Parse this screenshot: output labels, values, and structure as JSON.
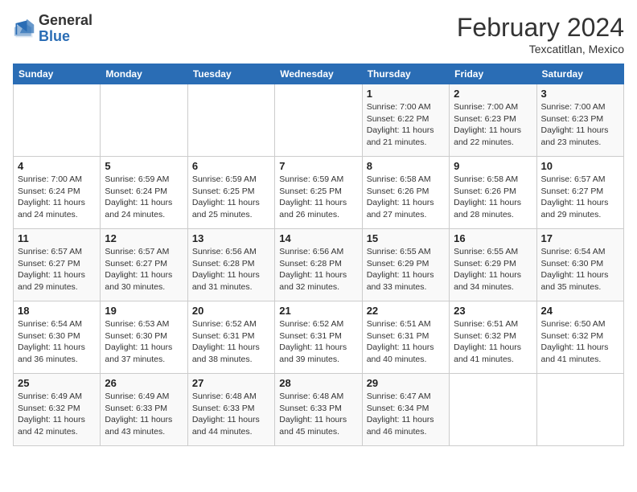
{
  "header": {
    "logo": {
      "line1": "General",
      "line2": "Blue"
    },
    "title": "February 2024",
    "subtitle": "Texcatitlan, Mexico"
  },
  "days_of_week": [
    "Sunday",
    "Monday",
    "Tuesday",
    "Wednesday",
    "Thursday",
    "Friday",
    "Saturday"
  ],
  "weeks": [
    [
      {
        "day": "",
        "info": ""
      },
      {
        "day": "",
        "info": ""
      },
      {
        "day": "",
        "info": ""
      },
      {
        "day": "",
        "info": ""
      },
      {
        "day": "1",
        "info": "Sunrise: 7:00 AM\nSunset: 6:22 PM\nDaylight: 11 hours\nand 21 minutes."
      },
      {
        "day": "2",
        "info": "Sunrise: 7:00 AM\nSunset: 6:23 PM\nDaylight: 11 hours\nand 22 minutes."
      },
      {
        "day": "3",
        "info": "Sunrise: 7:00 AM\nSunset: 6:23 PM\nDaylight: 11 hours\nand 23 minutes."
      }
    ],
    [
      {
        "day": "4",
        "info": "Sunrise: 7:00 AM\nSunset: 6:24 PM\nDaylight: 11 hours\nand 24 minutes."
      },
      {
        "day": "5",
        "info": "Sunrise: 6:59 AM\nSunset: 6:24 PM\nDaylight: 11 hours\nand 24 minutes."
      },
      {
        "day": "6",
        "info": "Sunrise: 6:59 AM\nSunset: 6:25 PM\nDaylight: 11 hours\nand 25 minutes."
      },
      {
        "day": "7",
        "info": "Sunrise: 6:59 AM\nSunset: 6:25 PM\nDaylight: 11 hours\nand 26 minutes."
      },
      {
        "day": "8",
        "info": "Sunrise: 6:58 AM\nSunset: 6:26 PM\nDaylight: 11 hours\nand 27 minutes."
      },
      {
        "day": "9",
        "info": "Sunrise: 6:58 AM\nSunset: 6:26 PM\nDaylight: 11 hours\nand 28 minutes."
      },
      {
        "day": "10",
        "info": "Sunrise: 6:57 AM\nSunset: 6:27 PM\nDaylight: 11 hours\nand 29 minutes."
      }
    ],
    [
      {
        "day": "11",
        "info": "Sunrise: 6:57 AM\nSunset: 6:27 PM\nDaylight: 11 hours\nand 29 minutes."
      },
      {
        "day": "12",
        "info": "Sunrise: 6:57 AM\nSunset: 6:27 PM\nDaylight: 11 hours\nand 30 minutes."
      },
      {
        "day": "13",
        "info": "Sunrise: 6:56 AM\nSunset: 6:28 PM\nDaylight: 11 hours\nand 31 minutes."
      },
      {
        "day": "14",
        "info": "Sunrise: 6:56 AM\nSunset: 6:28 PM\nDaylight: 11 hours\nand 32 minutes."
      },
      {
        "day": "15",
        "info": "Sunrise: 6:55 AM\nSunset: 6:29 PM\nDaylight: 11 hours\nand 33 minutes."
      },
      {
        "day": "16",
        "info": "Sunrise: 6:55 AM\nSunset: 6:29 PM\nDaylight: 11 hours\nand 34 minutes."
      },
      {
        "day": "17",
        "info": "Sunrise: 6:54 AM\nSunset: 6:30 PM\nDaylight: 11 hours\nand 35 minutes."
      }
    ],
    [
      {
        "day": "18",
        "info": "Sunrise: 6:54 AM\nSunset: 6:30 PM\nDaylight: 11 hours\nand 36 minutes."
      },
      {
        "day": "19",
        "info": "Sunrise: 6:53 AM\nSunset: 6:30 PM\nDaylight: 11 hours\nand 37 minutes."
      },
      {
        "day": "20",
        "info": "Sunrise: 6:52 AM\nSunset: 6:31 PM\nDaylight: 11 hours\nand 38 minutes."
      },
      {
        "day": "21",
        "info": "Sunrise: 6:52 AM\nSunset: 6:31 PM\nDaylight: 11 hours\nand 39 minutes."
      },
      {
        "day": "22",
        "info": "Sunrise: 6:51 AM\nSunset: 6:31 PM\nDaylight: 11 hours\nand 40 minutes."
      },
      {
        "day": "23",
        "info": "Sunrise: 6:51 AM\nSunset: 6:32 PM\nDaylight: 11 hours\nand 41 minutes."
      },
      {
        "day": "24",
        "info": "Sunrise: 6:50 AM\nSunset: 6:32 PM\nDaylight: 11 hours\nand 41 minutes."
      }
    ],
    [
      {
        "day": "25",
        "info": "Sunrise: 6:49 AM\nSunset: 6:32 PM\nDaylight: 11 hours\nand 42 minutes."
      },
      {
        "day": "26",
        "info": "Sunrise: 6:49 AM\nSunset: 6:33 PM\nDaylight: 11 hours\nand 43 minutes."
      },
      {
        "day": "27",
        "info": "Sunrise: 6:48 AM\nSunset: 6:33 PM\nDaylight: 11 hours\nand 44 minutes."
      },
      {
        "day": "28",
        "info": "Sunrise: 6:48 AM\nSunset: 6:33 PM\nDaylight: 11 hours\nand 45 minutes."
      },
      {
        "day": "29",
        "info": "Sunrise: 6:47 AM\nSunset: 6:34 PM\nDaylight: 11 hours\nand 46 minutes."
      },
      {
        "day": "",
        "info": ""
      },
      {
        "day": "",
        "info": ""
      }
    ]
  ]
}
